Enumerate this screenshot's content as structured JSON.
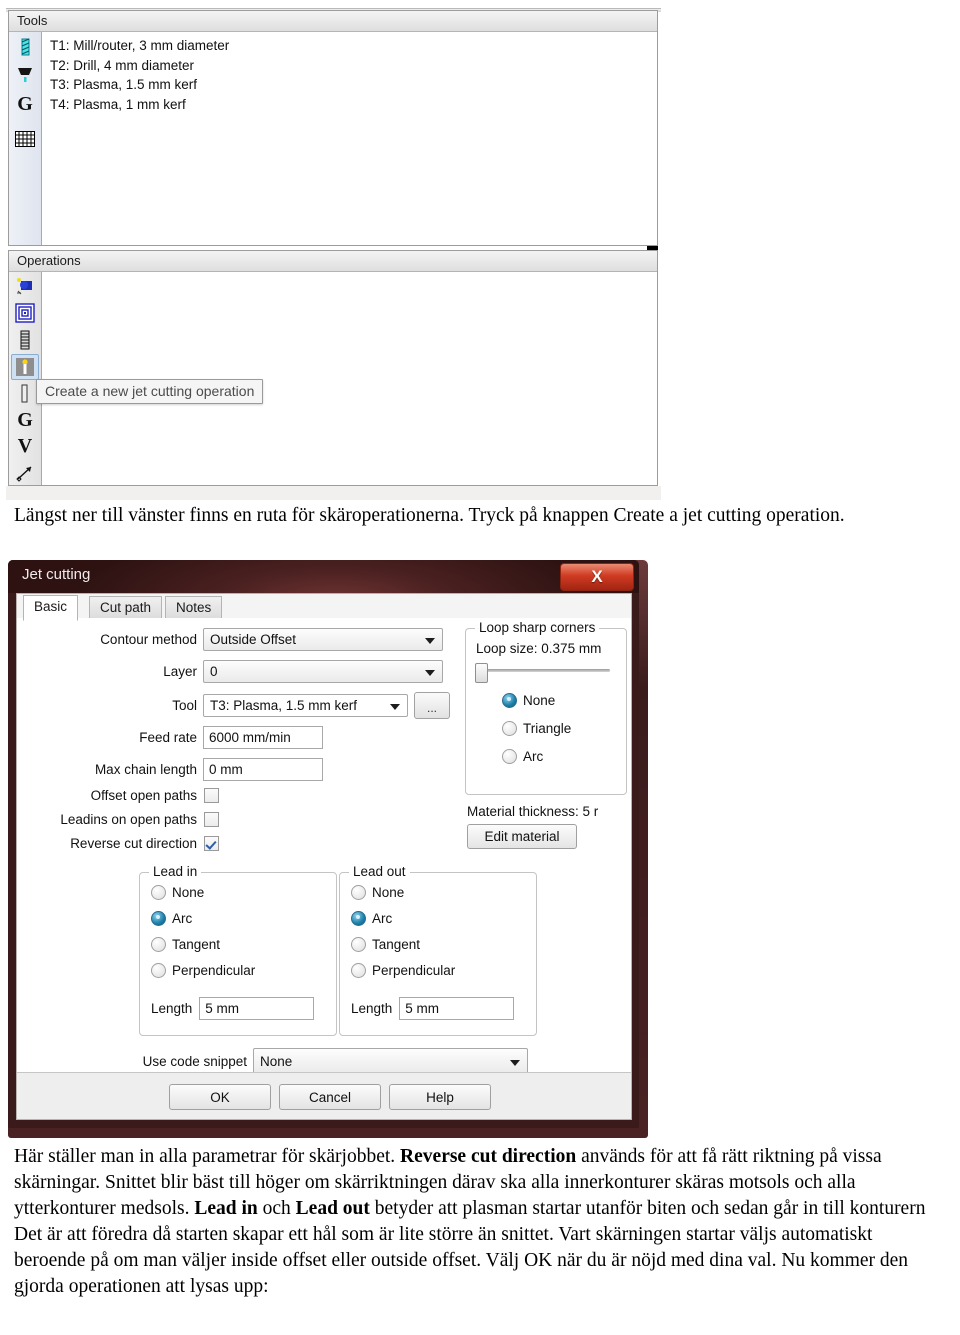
{
  "tools_panel": {
    "title": "Tools",
    "icons": [
      "mill-router-icon",
      "drill-icon",
      "g-letter-icon",
      "table-grid-icon"
    ],
    "items": [
      "T1: Mill/router, 3 mm diameter",
      "T2: Drill, 4 mm diameter",
      "T3: Plasma, 1.5 mm kerf",
      "T4: Plasma, 1 mm kerf"
    ]
  },
  "operations_panel": {
    "title": "Operations",
    "icons": [
      "pocket-icon",
      "profile-spiral-icon",
      "drill-holes-icon",
      "jet-cutting-icon",
      "engrave-icon",
      "g-letter-icon",
      "v-letter-icon",
      "arrow-diagonal-icon"
    ],
    "tooltip": "Create a new jet cutting operation",
    "items": []
  },
  "caption_top": "Längst ner till vänster finns en ruta för skäroperationerna. Tryck på knappen Create a jet cutting operation.",
  "dialog": {
    "title": "Jet cutting",
    "close_label": "X",
    "tabs": [
      {
        "label": "Basic",
        "active": true
      },
      {
        "label": "Cut path",
        "active": false
      },
      {
        "label": "Notes",
        "active": false
      }
    ],
    "fields": {
      "contour_method_label": "Contour method",
      "contour_method_value": "Outside Offset",
      "layer_label": "Layer",
      "layer_value": "0",
      "tool_label": "Tool",
      "tool_value": "T3: Plasma, 1.5 mm kerf",
      "tool_browse_label": "...",
      "feed_rate_label": "Feed rate",
      "feed_rate_value": "6000 mm/min",
      "max_chain_length_label": "Max chain length",
      "max_chain_length_value": "0 mm",
      "offset_open_paths_label": "Offset open paths",
      "offset_open_paths_checked": false,
      "leadins_on_open_paths_label": "Leadins on open paths",
      "leadins_on_open_paths_checked": false,
      "reverse_cut_direction_label": "Reverse cut direction",
      "reverse_cut_direction_checked": true
    },
    "loop_group": {
      "title": "Loop sharp corners",
      "loop_size_label": "Loop size: 0.375 mm",
      "options": [
        {
          "label": "None",
          "selected": true
        },
        {
          "label": "Triangle",
          "selected": false
        },
        {
          "label": "Arc",
          "selected": false
        }
      ]
    },
    "material": {
      "thickness_label": "Material thickness: 5 r",
      "edit_button_label": "Edit material"
    },
    "lead_in": {
      "title": "Lead in",
      "options": [
        {
          "label": "None",
          "selected": false
        },
        {
          "label": "Arc",
          "selected": true
        },
        {
          "label": "Tangent",
          "selected": false
        },
        {
          "label": "Perpendicular",
          "selected": false
        }
      ],
      "length_label": "Length",
      "length_value": "5 mm"
    },
    "lead_out": {
      "title": "Lead out",
      "options": [
        {
          "label": "None",
          "selected": false
        },
        {
          "label": "Arc",
          "selected": true
        },
        {
          "label": "Tangent",
          "selected": false
        },
        {
          "label": "Perpendicular",
          "selected": false
        }
      ],
      "length_label": "Length",
      "length_value": "5 mm"
    },
    "snippet": {
      "label": "Use code snippet",
      "value": "None"
    },
    "buttons": {
      "ok": "OK",
      "cancel": "Cancel",
      "help": "Help"
    }
  },
  "caption_bottom": {
    "p1_a": "Här ställer man in alla parametrar för skärjobbet. ",
    "p1_b": "Reverse cut direction",
    "p1_c": " används för att få rätt riktning på vissa skärningar. Snittet blir bäst till höger om skärriktningen därav ska alla innerkonturer skäras motsols och alla ytterkonturer medsols. ",
    "p1_d": "Lead in",
    "p1_e": " och ",
    "p1_f": "Lead out",
    "p1_g": " betyder att plasman startar utanför biten och sedan går in till konturern Det är att föredra då starten skapar ett hål som är lite större än snittet. Vart skärningen startar väljs automatiskt beroende på om man väljer inside offset eller outside offset.  Välj OK när du är nöjd med dina val. Nu kommer den gjorda operationen att lysas upp:"
  },
  "colors": {
    "dialog_titlebar": "#3a1a1a",
    "close_button": "#cf3b22",
    "radio_selected": "#1b7fa8",
    "checkbox_check": "#2b5fa8",
    "panel_header": "#ededed"
  }
}
